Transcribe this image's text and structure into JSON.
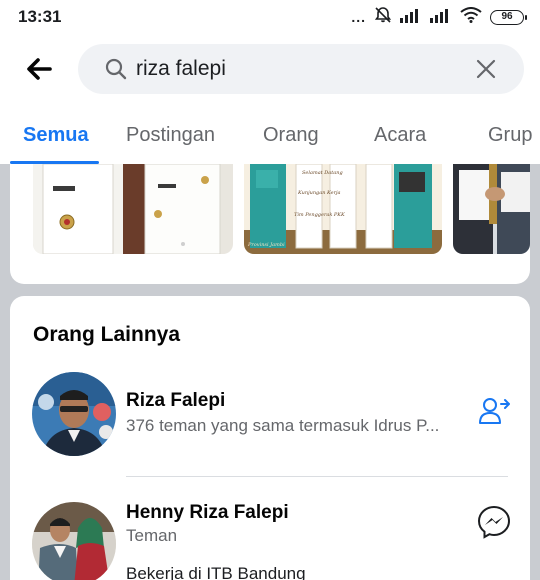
{
  "status_bar": {
    "time": "13:31",
    "dots": "...",
    "battery": "96",
    "icons": [
      "alarm-off-icon",
      "signal-icon",
      "signal-icon",
      "wifi-icon",
      "battery-icon"
    ]
  },
  "search": {
    "value": "riza falepi",
    "back_icon": "back-arrow-icon",
    "search_icon": "search-icon",
    "clear_icon": "close-icon"
  },
  "tabs": [
    {
      "label": "Semua",
      "active": true
    },
    {
      "label": "Postingan",
      "active": false
    },
    {
      "label": "Orang",
      "active": false
    },
    {
      "label": "Acara",
      "active": false
    },
    {
      "label": "Grup",
      "active": false
    }
  ],
  "photos": {
    "items": [
      {
        "name": "photo-uniform-officials"
      },
      {
        "name": "photo-event-banner",
        "caption_lines": [
          "Selamat Datang Di Kabupaten Kerinci",
          "Kunjungan Kerja",
          "Rombongan Tim Penggerak PKK",
          "Provinsi Jambi"
        ]
      },
      {
        "name": "photo-handshake"
      }
    ]
  },
  "people_section": {
    "title": "Orang Lainnya",
    "people": [
      {
        "name": "Riza Falepi",
        "subtitle": "376 teman yang sama termasuk Idrus P...",
        "action_icon": "add-friend-icon"
      },
      {
        "name": "Henny Riza Falepi",
        "subtitle": "Teman",
        "extra": "Bekerja di ITB Bandung",
        "action_icon": "messenger-icon"
      }
    ]
  },
  "colors": {
    "accent": "#1877f2",
    "background": "#c9ccd1",
    "secondary_text": "#65676b"
  }
}
